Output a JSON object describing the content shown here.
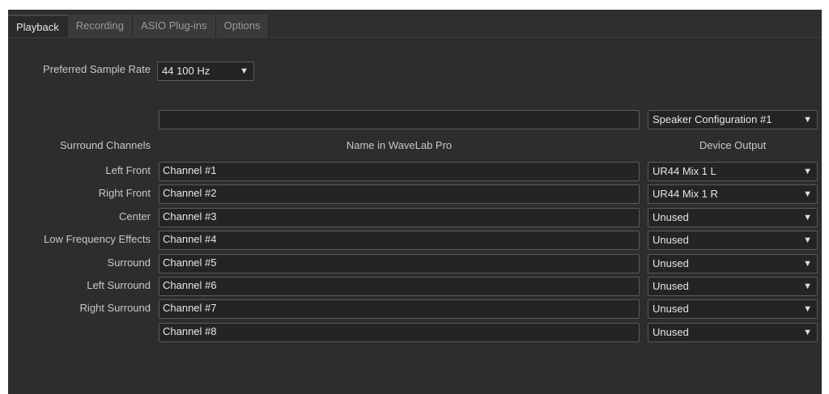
{
  "tabs": [
    "Playback",
    "Recording",
    "ASIO Plug-ins",
    "Options"
  ],
  "active_tab": "Playback",
  "sample_rate": {
    "label": "Preferred Sample Rate",
    "value": "44 100 Hz"
  },
  "speaker_config": {
    "name_value": "",
    "value": "Speaker Configuration #1"
  },
  "headers": {
    "surround_channels": "Surround Channels",
    "name": "Name in WaveLab Pro",
    "device_output": "Device Output"
  },
  "channels": [
    {
      "surround": "Left Front",
      "name": "Channel #1",
      "output": "UR44 Mix 1 L"
    },
    {
      "surround": "Right Front",
      "name": "Channel #2",
      "output": "UR44 Mix 1 R"
    },
    {
      "surround": "Center",
      "name": "Channel #3",
      "output": "Unused"
    },
    {
      "surround": "Low Frequency Effects",
      "name": "Channel #4",
      "output": "Unused"
    },
    {
      "surround": "Surround",
      "name": "Channel #5",
      "output": "Unused"
    },
    {
      "surround": "Left Surround",
      "name": "Channel #6",
      "output": "Unused"
    },
    {
      "surround": "Right Surround",
      "name": "Channel #7",
      "output": "Unused"
    },
    {
      "surround": "",
      "name": "Channel #8",
      "output": "Unused"
    }
  ],
  "icons": {
    "dropdown": "chevron-down-icon"
  }
}
